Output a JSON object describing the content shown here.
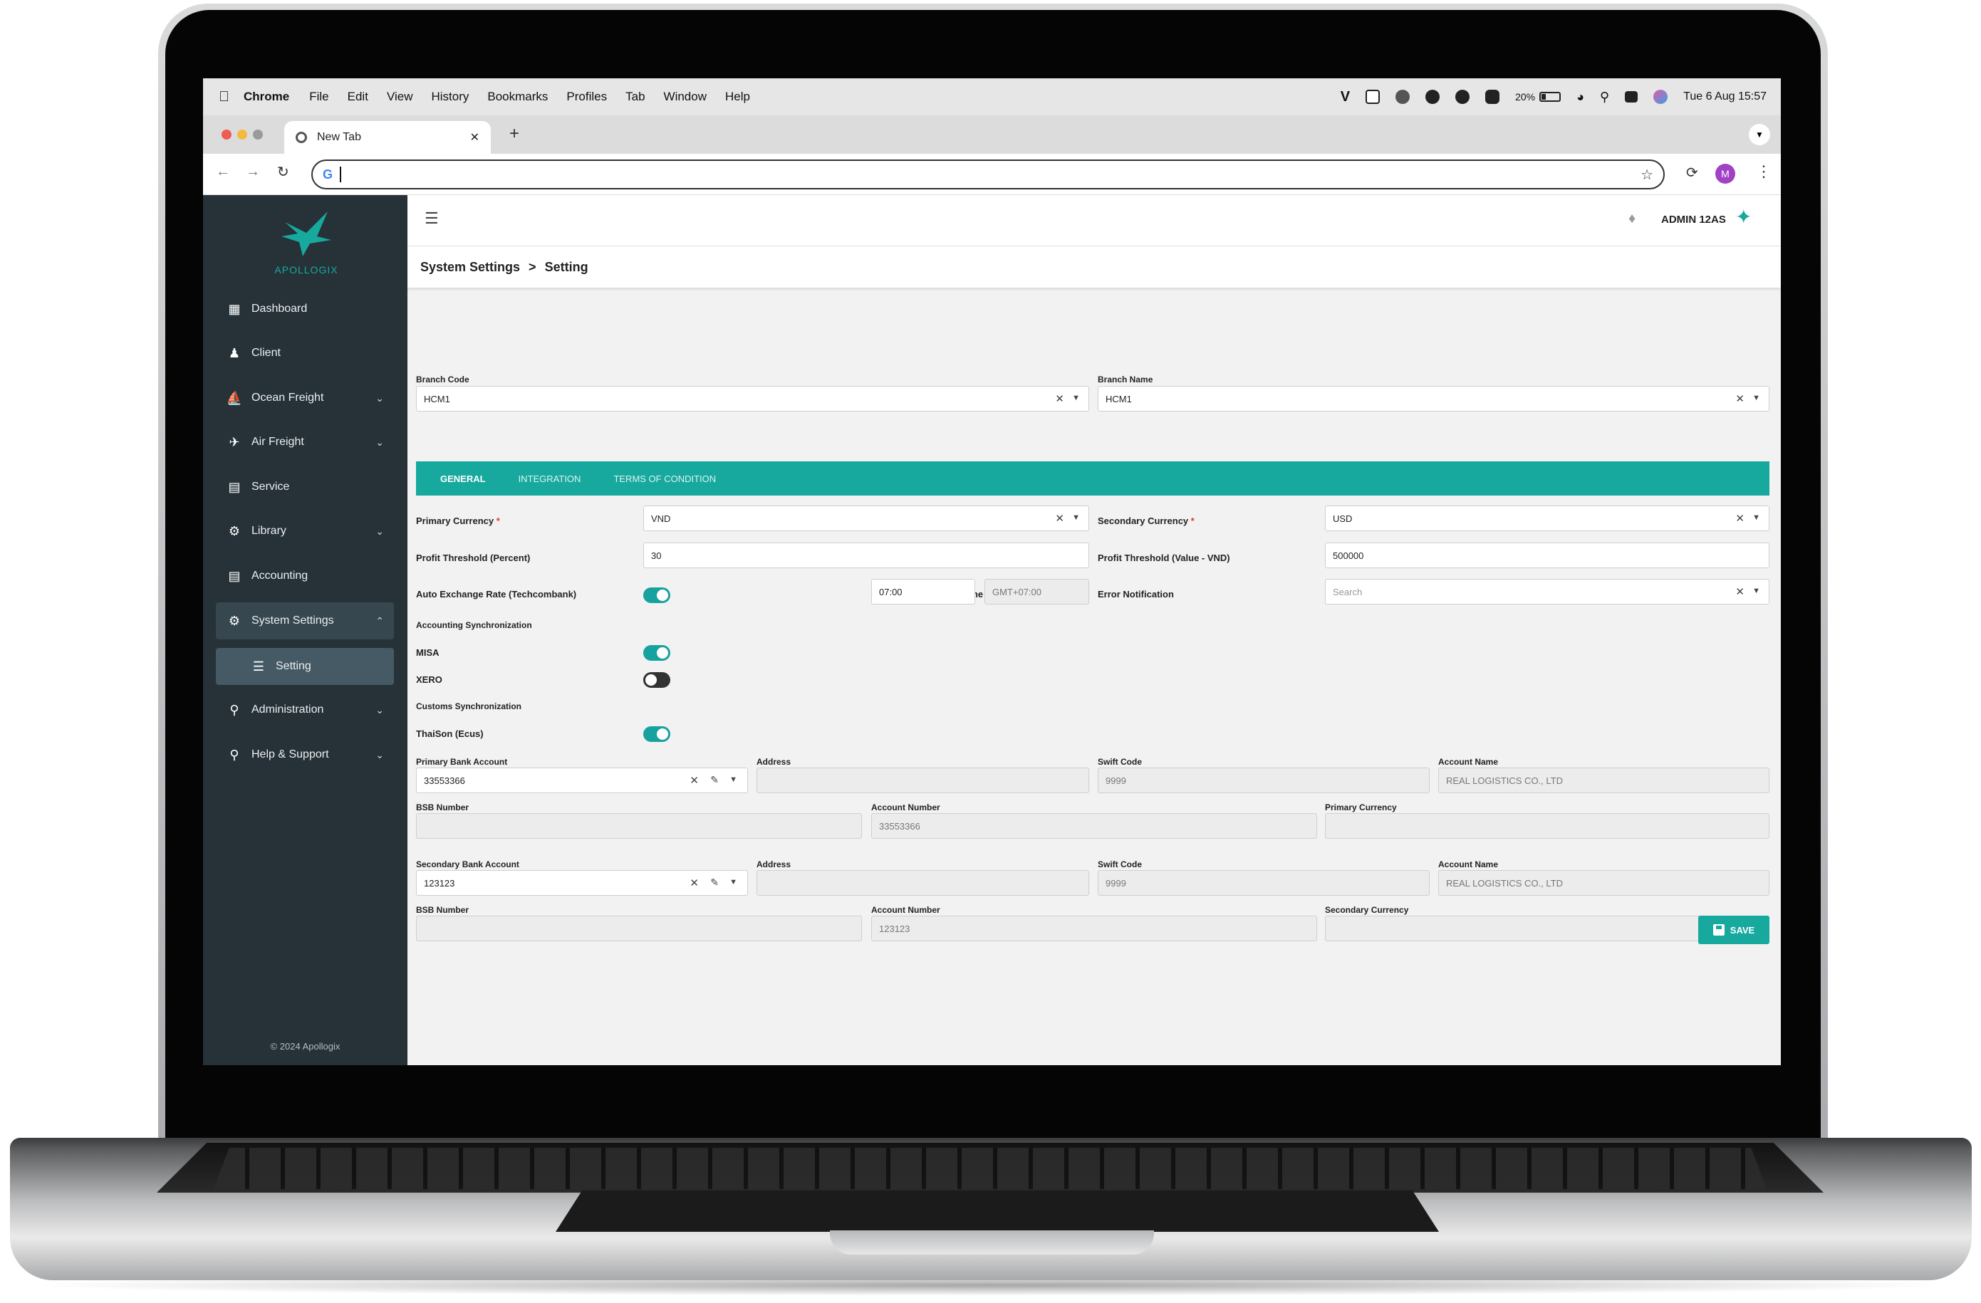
{
  "menubar": {
    "app": "Chrome",
    "items": [
      "File",
      "Edit",
      "View",
      "History",
      "Bookmarks",
      "Profiles",
      "Tab",
      "Window",
      "Help"
    ],
    "battery": "20%",
    "clock": "Tue 6 Aug  15:57"
  },
  "browser": {
    "tab_title": "New Tab",
    "new_tab": "+",
    "profile_initial": "M",
    "address_value": ""
  },
  "brand": {
    "name": "APOLLOGIX",
    "accent": "#17a89e",
    "sidebar_bg": "#263238"
  },
  "sidebar": {
    "items": [
      {
        "label": "Dashboard",
        "icon": "dashboard-icon"
      },
      {
        "label": "Client",
        "icon": "people-icon"
      },
      {
        "label": "Ocean Freight",
        "icon": "ship-icon"
      },
      {
        "label": "Air Freight",
        "icon": "airplane-icon"
      },
      {
        "label": "Service",
        "icon": "list-icon"
      },
      {
        "label": "Library",
        "icon": "gear-icon"
      },
      {
        "label": "Accounting",
        "icon": "ledger-icon"
      },
      {
        "label": "System Settings",
        "icon": "gear-icon"
      },
      {
        "label": "Setting",
        "icon": "sliders-icon"
      },
      {
        "label": "Administration",
        "icon": "key-icon"
      },
      {
        "label": "Help & Support",
        "icon": "key-icon"
      }
    ],
    "footer": "© 2024 Apollogix"
  },
  "header": {
    "user": "ADMIN 12AS"
  },
  "breadcrumb": {
    "parent": "System Settings",
    "sep": ">",
    "current": "Setting"
  },
  "branch": {
    "code_label": "Branch Code",
    "code_value": "HCM1",
    "name_label": "Branch Name",
    "name_value": "HCM1"
  },
  "tabs": [
    "GENERAL",
    "INTEGRATION",
    "TERMS OF CONDITION"
  ],
  "general": {
    "primary_currency_label": "Primary Currency",
    "primary_currency_value": "VND",
    "secondary_currency_label": "Secondary Currency",
    "secondary_currency_value": "USD",
    "required_mark": "*",
    "profit_pct_label": "Profit Threshold (Percent)",
    "profit_pct_value": "30",
    "profit_val_label": "Profit Threshold (Value - VND)",
    "profit_val_value": "500000",
    "auto_rate_label": "Auto Exchange Rate (Techcombank)",
    "auto_rate_on": true,
    "time_label": "Time",
    "time_value": "07:00",
    "tz_value": "GMT+07:00",
    "error_label": "Error Notification",
    "error_placeholder": "Search",
    "acc_sync_label": "Accounting Synchronization",
    "misa_label": "MISA",
    "misa_on": true,
    "xero_label": "XERO",
    "xero_on": false,
    "customs_label": "Customs Synchronization",
    "thaison_label": "ThaiSon (Ecus)",
    "thaison_on": true
  },
  "bank1": {
    "account_label": "Primary Bank Account",
    "account_value": "33553366",
    "address_label": "Address",
    "address_value": "",
    "swift_label": "Swift Code",
    "swift_value": "9999",
    "name_label": "Account Name",
    "name_value": "REAL LOGISTICS CO., LTD",
    "bsb_label": "BSB Number",
    "bsb_value": "",
    "number_label": "Account Number",
    "number_value": "33553366",
    "currency_label": "Primary Currency",
    "currency_value": ""
  },
  "bank2": {
    "account_label": "Secondary Bank Account",
    "account_value": "123123",
    "address_label": "Address",
    "address_value": "",
    "swift_label": "Swift Code",
    "swift_value": "9999",
    "name_label": "Account Name",
    "name_value": "REAL LOGISTICS CO., LTD",
    "bsb_label": "BSB Number",
    "bsb_value": "",
    "number_label": "Account Number",
    "number_value": "123123",
    "currency_label": "Secondary Currency",
    "currency_value": ""
  },
  "actions": {
    "save": "SAVE"
  }
}
